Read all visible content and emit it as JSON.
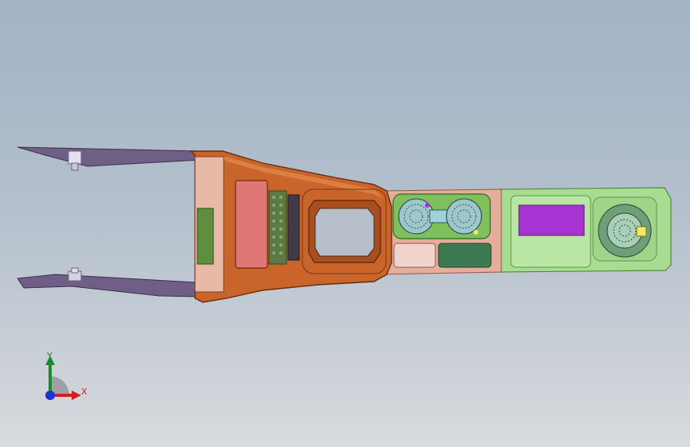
{
  "viewport": {
    "background_top": "#a2b3c6",
    "background_bottom": "#d8dbde"
  },
  "model": {
    "description_icon": "center-console-assembly-icon",
    "colors": {
      "bezel": "#c9652a",
      "bezel_dark": "#8e3d14",
      "storage_pad": "#de7776",
      "grille": "#5b7a46",
      "cupholder_tray": "#7fbf5e",
      "cupholder_mesh": "#9fc7c9",
      "trim_panel": "#e5ad9a",
      "rear_bin": "#a8dc92",
      "rear_lid": "#a733d2",
      "side_rails": "#6f5f86"
    }
  },
  "triad": {
    "x_label": "X",
    "y_label": "Y",
    "x_color": "#d02020",
    "y_color": "#1b8a2a",
    "z_color": "#1a35d0"
  }
}
